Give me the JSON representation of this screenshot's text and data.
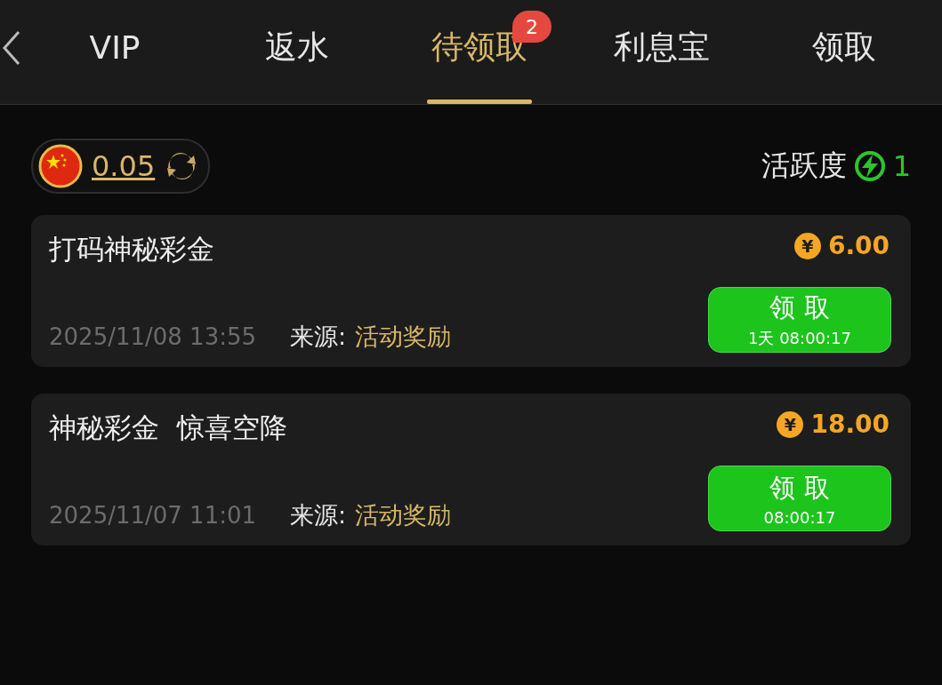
{
  "tabs": [
    {
      "label": "VIP",
      "selected": false
    },
    {
      "label": "返水",
      "selected": false
    },
    {
      "label": "待领取",
      "selected": true,
      "badge": "2"
    },
    {
      "label": "利息宝",
      "selected": false
    },
    {
      "label": "领取",
      "selected": false
    }
  ],
  "balance": {
    "amount": "0.05"
  },
  "activity": {
    "label": "活跃度",
    "value": "1"
  },
  "rewards": [
    {
      "title": "打码神秘彩金",
      "currency_symbol": "¥",
      "amount": "6.00",
      "date": "2025/11/08 13:55",
      "source_label": "来源:",
      "source": "活动奖励",
      "button": "领 取",
      "countdown": "1天 08:00:17"
    },
    {
      "title": "神秘彩金  惊喜空降",
      "currency_symbol": "¥",
      "amount": "18.00",
      "date": "2025/11/07 11:01",
      "source_label": "来源:",
      "source": "活动奖励",
      "button": "领 取",
      "countdown": "08:00:17"
    }
  ]
}
